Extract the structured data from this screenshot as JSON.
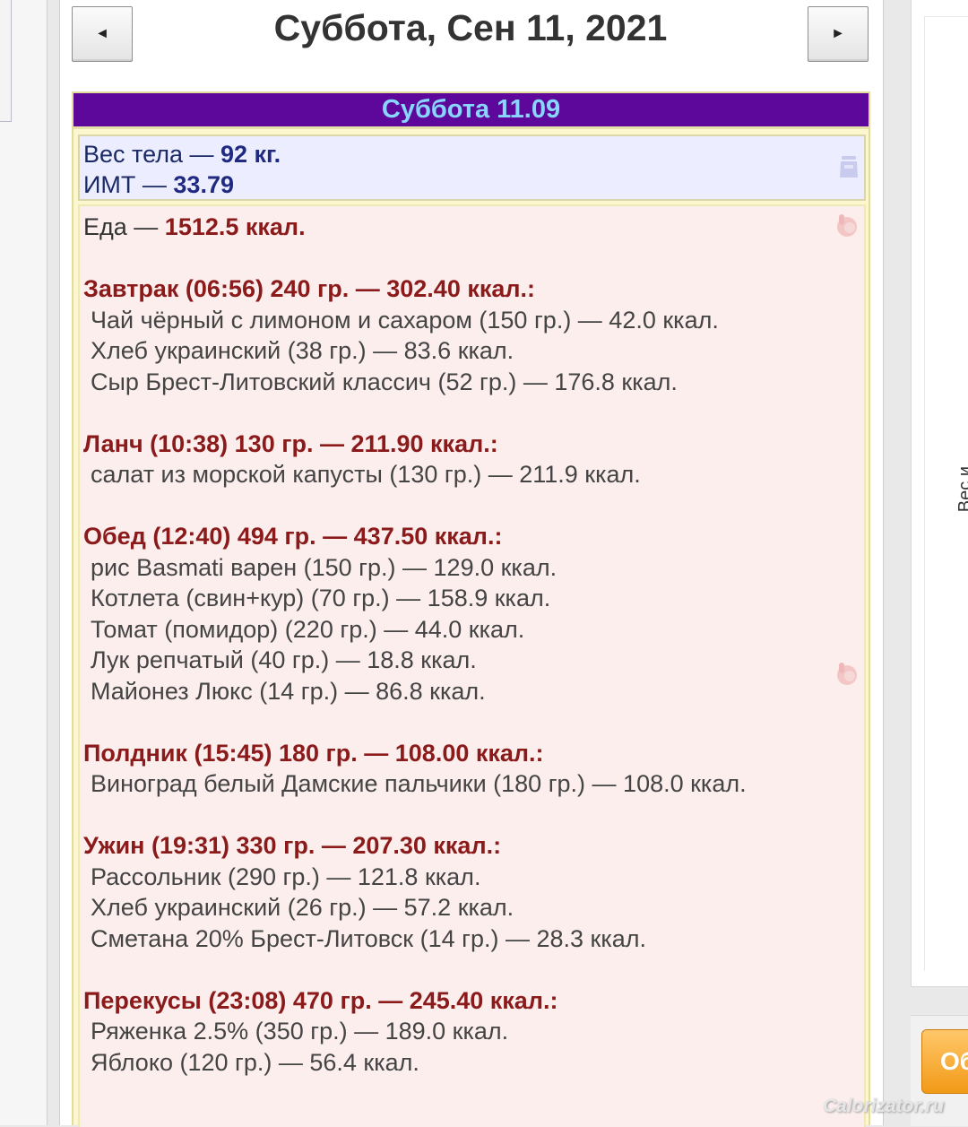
{
  "header": {
    "prev_label": "◄",
    "next_label": "►",
    "date": "Суббота, Сен 11, 2021"
  },
  "day": {
    "title": "Суббота 11.09",
    "weight_label": "Вес тела — ",
    "weight_value": "92 кг.",
    "bmi_label": "ИМТ — ",
    "bmi_value": "33.79",
    "food_label": "Еда — ",
    "food_value": "1512.5 ккал."
  },
  "meals": [
    {
      "header": "Завтрак (06:56) 240 гр. — 302.40 ккал.:",
      "items": [
        "Чай чёрный с лимоном и сахаром (150 гр.) — 42.0 ккал.",
        "Хлеб украинский (38 гр.) — 83.6 ккал.",
        "Сыр Брест-Литовский классич (52 гр.) — 176.8 ккал."
      ]
    },
    {
      "header": "Ланч (10:38) 130 гр. — 211.90 ккал.:",
      "items": [
        "салат из морской капусты (130 гр.) — 211.9 ккал."
      ]
    },
    {
      "header": "Обед (12:40) 494 гр. — 437.50 ккал.:",
      "items": [
        "рис Basmati варен (150 гр.) — 129.0 ккал.",
        "Котлета (свин+кур) (70 гр.) — 158.9 ккал.",
        "Томат (помидор) (220 гр.) — 44.0 ккал.",
        "Лук репчатый (40 гр.) — 18.8 ккал.",
        "Майонез Люкс (14 гр.) — 86.8 ккал."
      ]
    },
    {
      "header": "Полдник (15:45) 180 гр. — 108.00 ккал.:",
      "items": [
        "Виноград белый Дамские пальчики (180 гр.) — 108.0 ккал."
      ]
    },
    {
      "header": "Ужин (19:31) 330 гр. — 207.30 ккал.:",
      "items": [
        "Рассольник (290 гр.) — 121.8 ккал.",
        "Хлеб украинский (26 гр.) — 57.2 ккал.",
        "Сметана 20% Брест-Литовск (14 гр.) — 28.3 ккал."
      ]
    },
    {
      "header": "Перекусы (23:08) 470 гр. — 245.40 ккал.:",
      "items": [
        "Ряженка 2.5% (350 гр.) — 189.0 ккал.",
        "Яблоко (120 гр.) — 56.4 ккал."
      ]
    }
  ],
  "side": {
    "vertical_text": "Вес и",
    "orange_button": "Об"
  },
  "watermark": "Calorizator.ru",
  "colors": {
    "header_bar": "#5d089a",
    "header_text": "#88d6ff",
    "meal_header": "#8b1a1a",
    "weight_bg": "#eceeff",
    "food_bg": "#fdeeee",
    "orange": "#f29a17"
  },
  "icons": {
    "weight": "scale-icon",
    "food": "hand-pointer-icon"
  }
}
